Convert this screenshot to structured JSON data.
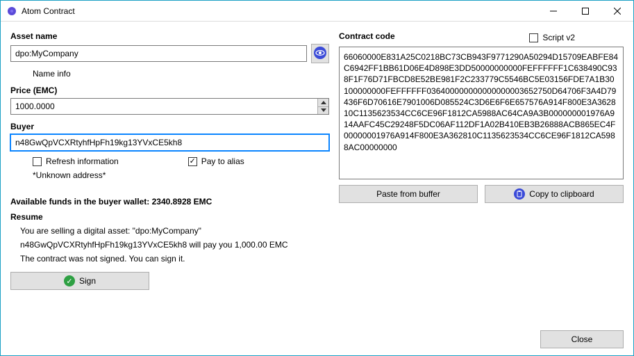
{
  "window": {
    "title": "Atom Contract"
  },
  "left": {
    "asset_label": "Asset name",
    "asset_value": "dpo:MyCompany",
    "name_info": "Name info",
    "price_label": "Price (EMC)",
    "price_value": "1000.0000",
    "buyer_label": "Buyer",
    "buyer_value": "n48GwQpVCXRtyhfHpFh19kg13YVxCE5kh8",
    "refresh_label": "Refresh information",
    "paytoalias_label": "Pay to alias",
    "unknown": "*Unknown address*"
  },
  "right": {
    "code_label": "Contract code",
    "script_label": "Script v2",
    "code_value": "66060000E831A25C0218BC73CB943F9771290A50294D15709EABFE84C6942FF1BB61D06E4D898E3DD50000000000FEFFFFFF1C638490C938F1F76D71FBCD8E52BE981F2C233779C5546BC5E03156FDE7A1B30100000000FEFFFFFF036400000000000000003652750D64706F3A4D79436F6D70616E7901006D085524C3D6E6F6E657576A914F800E3A362810C1135623534CC6CE96F1812CA5988AC64CA9A3B000000001976A914AAFC45C29248F5DC06AF112DF1A02B410EB3B26888ACB865EC4F00000001976A914F800E3A362810C1135623534CC6CE96F1812CA5988AC00000000",
    "paste_btn": "Paste from buffer",
    "copy_btn": "Copy to clipboard"
  },
  "footer": {
    "available": "Available funds in the buyer wallet: 2340.8928 EMC",
    "resume_label": "Resume",
    "line1": "You are selling a digital asset: \"dpo:MyCompany\"",
    "line2": "n48GwQpVCXRtyhfHpFh19kg13YVxCE5kh8 will pay you 1,000.00 EMC",
    "line3": "The contract was not signed. You can sign it.",
    "sign_btn": "Sign",
    "close_btn": "Close"
  }
}
